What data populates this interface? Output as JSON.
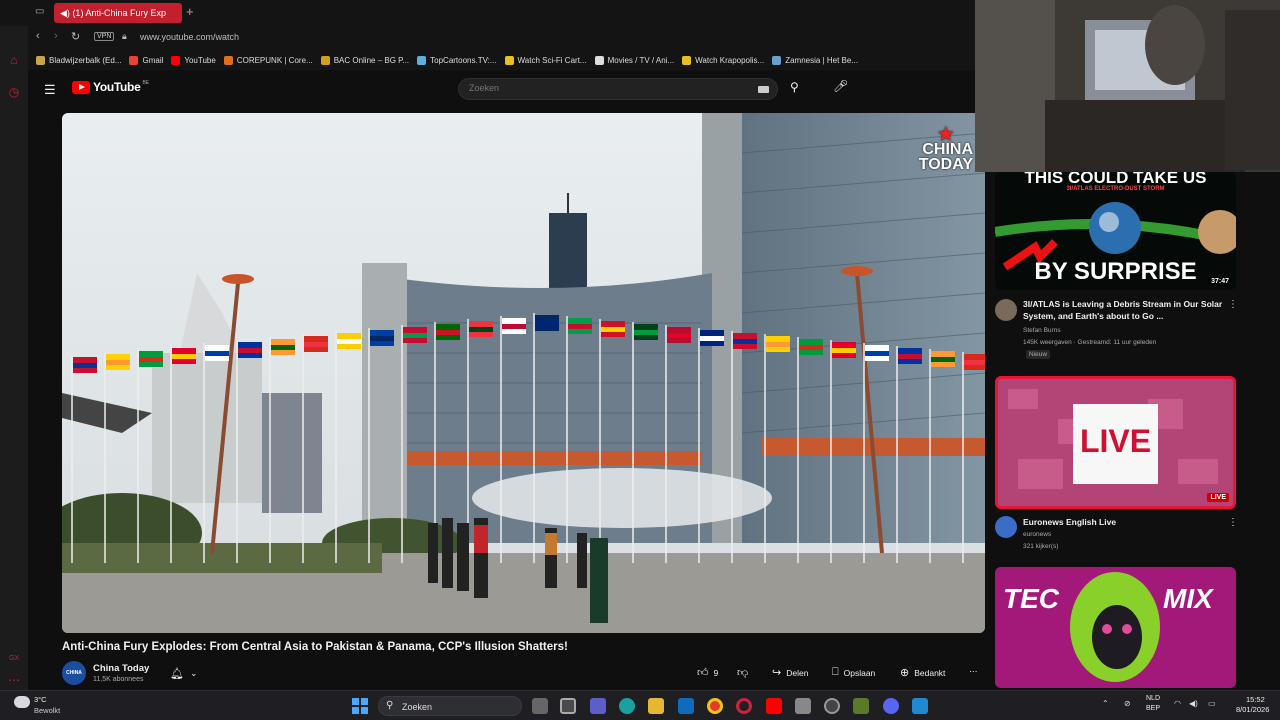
{
  "browser": {
    "tab_title": "(1) Anti-China Fury Exp",
    "new_tab": "+",
    "url": "www.youtube.com/watch",
    "vpn": "VPN",
    "bookmarks": [
      {
        "label": "Bladwijzerbalk (Ed...",
        "color": "#c9a64a"
      },
      {
        "label": "Gmail",
        "color": "#ea4335"
      },
      {
        "label": "YouTube",
        "color": "#ff0000"
      },
      {
        "label": "COREPUNK | Core...",
        "color": "#e07020"
      },
      {
        "label": "BAC Online – BG P...",
        "color": "#d0a020"
      },
      {
        "label": "TopCartoons.TV:...",
        "color": "#5ab0e0"
      },
      {
        "label": "Watch Sci-Fi Cart...",
        "color": "#e8c020"
      },
      {
        "label": "Movies / TV / Ani...",
        "color": "#dddddd"
      },
      {
        "label": "Watch Krapopolis...",
        "color": "#e8c020"
      },
      {
        "label": "Zamnesia | Het Be...",
        "color": "#6aa0d0"
      }
    ]
  },
  "youtube": {
    "logo": "YouTube",
    "region": "BE",
    "search_placeholder": "Zoeken"
  },
  "video": {
    "watermark_line1": "CHINA",
    "watermark_line2": "TODAY",
    "title": "Anti-China Fury Explodes: From Central Asia to Pakistan & Panama, CCP's Illusion Shatters!",
    "channel": "China Today",
    "channel_avatar_text": "CHINA TODAY",
    "subscribers": "11,5K abonnees",
    "likes": "9",
    "share": "Delen",
    "save": "Opslaan",
    "thanks": "Bedankt",
    "more": "⋯"
  },
  "recommendations": [
    {
      "thumb_top": "THIS COULD TAKE US",
      "thumb_sub": "3I/ATLAS ELECTRO-DUST STORM",
      "thumb_bottom": "BY SURPRISE",
      "duration": "37:47",
      "title": "3I/ATLAS is Leaving a Debris Stream in Our Solar System, and Earth's about to Go ...",
      "channel": "Stefan Burns",
      "meta": "145K weergaven · Gestreamd: 11 uur geleden",
      "badge": "Nieuw"
    },
    {
      "thumb_text": "LIVE",
      "badge": "LIVE",
      "title": "Euronews English Live",
      "channel": "euronews",
      "meta": "321 kijker(s)"
    },
    {
      "thumb_left": "TEC",
      "thumb_right": "MIX"
    }
  ],
  "taskbar": {
    "temperature": "3°C",
    "weather": "Bewolkt",
    "search": "Zoeken",
    "lang1": "NLD",
    "lang2": "BEP",
    "time": "15:52",
    "date": "8/01/2026"
  }
}
